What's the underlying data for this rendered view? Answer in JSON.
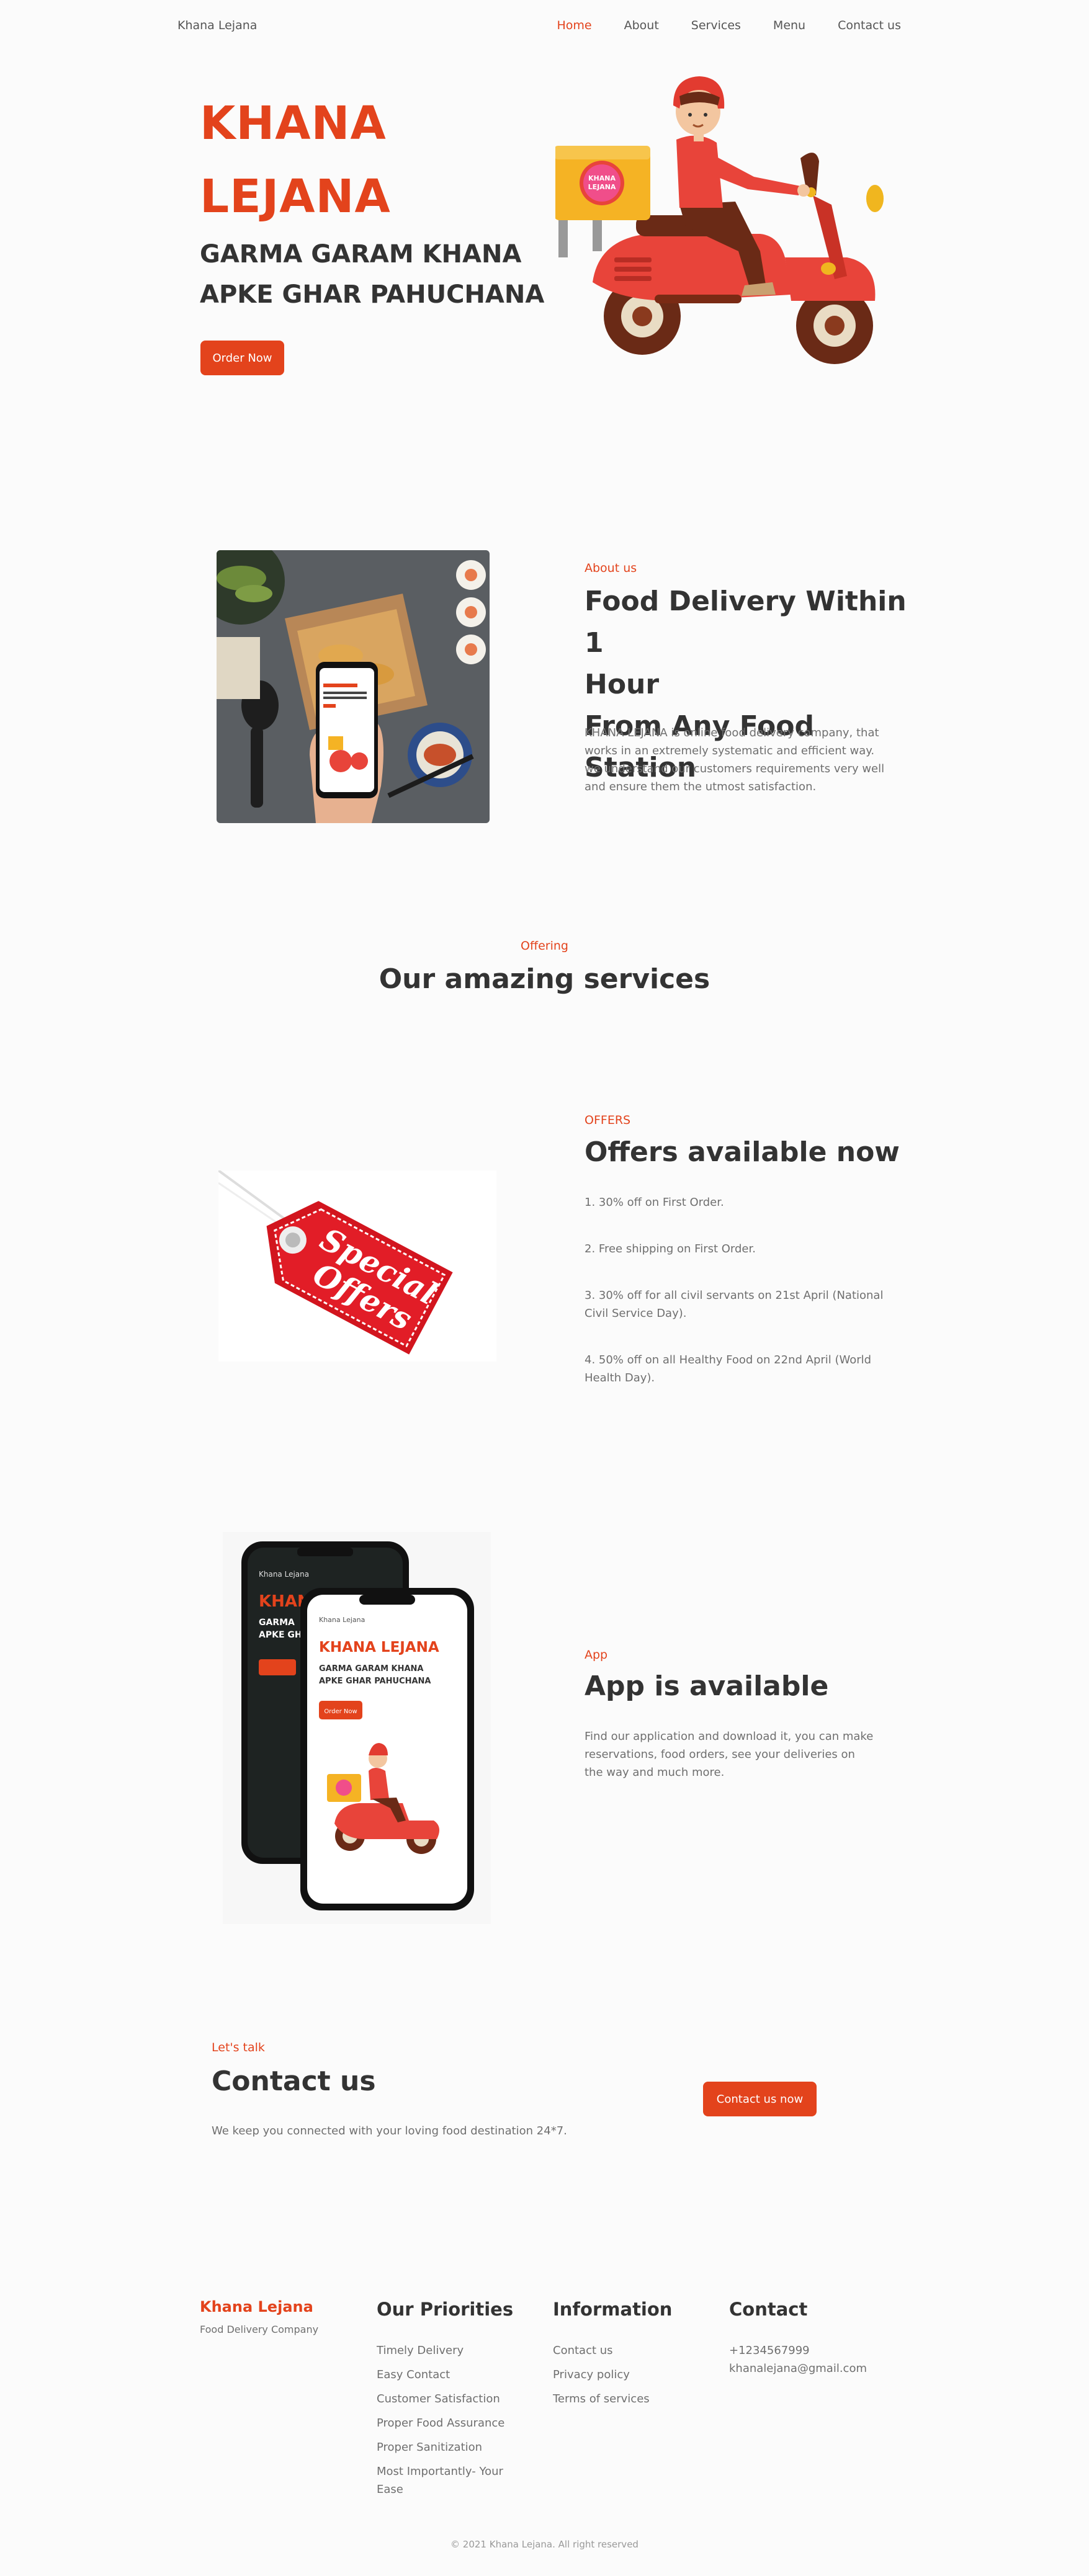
{
  "nav": {
    "brand": "Khana Lejana",
    "links": [
      "Home",
      "About",
      "Services",
      "Menu",
      "Contact us"
    ]
  },
  "hero": {
    "title_line1": "KHANA",
    "title_line2": "LEJANA",
    "subtitle_line1": "GARMA GARAM KHANA",
    "subtitle_line2": "APKE GHAR PAHUCHANA",
    "cta": "Order Now",
    "box_logo_line1": "KHANA",
    "box_logo_line2": "LEJANA"
  },
  "about": {
    "eyebrow": "About us",
    "heading_line1": "Food Delivery Within 1",
    "heading_line2": "Hour",
    "heading_line3": "From Any Food Station",
    "paragraph": "KHANA LEJANA is online food delivery company, that works in an extremely systematic and efficient way. we understand our customers requirements very well and ensure them the utmost satisfaction."
  },
  "services": {
    "eyebrow": "Offering",
    "heading": "Our amazing services"
  },
  "offers": {
    "eyebrow": "OFFERS",
    "heading": "Offers available now",
    "tag_line1": "Special",
    "tag_line2": "Offers",
    "items": [
      "1. 30% off on First Order.",
      "2. Free shipping on First Order.",
      "3. 30% off for all civil servants on 21st April (National Civil Service Day).",
      "4. 50% off on all Healthy Food on 22nd April (World Health Day)."
    ]
  },
  "app": {
    "eyebrow": "App",
    "heading": "App is available",
    "paragraph": "Find our application and download it, you can make reservations, food orders, see your deliveries on the way and much more.",
    "phone_brand": "Khana Lejana",
    "phone_title": "KHANA LEJANA",
    "phone_sub1": "GARMA GARAM KHANA",
    "phone_sub2": "APKE GHAR PAHUCHANA",
    "phone_cta": "Order Now"
  },
  "contact": {
    "eyebrow": "Let's talk",
    "heading": "Contact us",
    "paragraph": "We keep you connected with your loving food destination 24*7.",
    "cta": "Contact us now"
  },
  "footer": {
    "brand": "Khana Lejana",
    "tagline": "Food Delivery Company",
    "priorities": {
      "heading": "Our Priorities",
      "items": [
        "Timely Delivery",
        "Easy Contact",
        "Customer Satisfaction",
        "Proper Food Assurance",
        "Proper Sanitization",
        "Most Importantly- Your Ease"
      ]
    },
    "information": {
      "heading": "Information",
      "items": [
        "Contact us",
        "Privacy policy",
        "Terms of services"
      ]
    },
    "contact": {
      "heading": "Contact",
      "phone": "+1234567999",
      "email": "khanalejana@gmail.com"
    },
    "copyright": "© 2021 Khana Lejana. All right reserved"
  },
  "colors": {
    "accent": "#e3431c",
    "text": "#333333",
    "muted": "#6f6f6f",
    "background": "#fbfbfb"
  }
}
